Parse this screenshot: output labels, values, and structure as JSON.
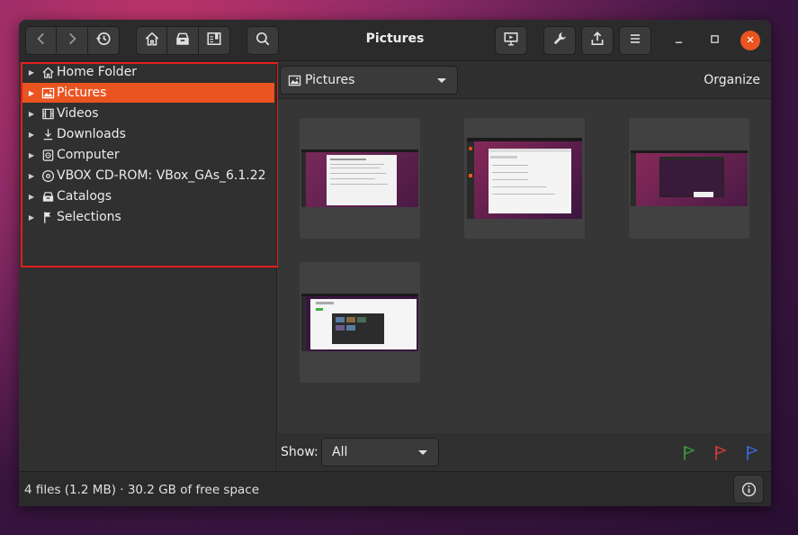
{
  "window": {
    "title": "Pictures"
  },
  "toolbar": {
    "back_icon": "chevron-left-icon",
    "forward_icon": "chevron-right-icon",
    "history_icon": "history-icon",
    "home_icon": "home-icon",
    "catalog_icon": "catalog-icon",
    "bookmarks_icon": "bookmarks-icon",
    "search_icon": "search-icon",
    "slideshow_icon": "slideshow-icon",
    "tools_icon": "wrench-icon",
    "share_icon": "share-icon",
    "menu_icon": "hamburger-menu-icon"
  },
  "sidebar": {
    "items": [
      {
        "label": "Home Folder",
        "icon": "home-icon"
      },
      {
        "label": "Pictures",
        "icon": "image-icon",
        "selected": true
      },
      {
        "label": "Videos",
        "icon": "film-icon"
      },
      {
        "label": "Downloads",
        "icon": "download-icon"
      },
      {
        "label": "Computer",
        "icon": "drive-icon"
      },
      {
        "label": "VBOX CD-ROM: VBox_GAs_6.1.22",
        "icon": "disc-icon"
      },
      {
        "label": "Catalogs",
        "icon": "catalog-icon"
      },
      {
        "label": "Selections",
        "icon": "flag-icon"
      }
    ]
  },
  "location": {
    "label": "Pictures",
    "icon": "image-icon"
  },
  "organize_label": "Organize",
  "thumbnails_count": 4,
  "filter": {
    "show_label": "Show:",
    "value": "All"
  },
  "flags": {
    "green": "#3c9a3c",
    "red": "#d83a3a",
    "blue": "#3a6ad8"
  },
  "status": {
    "text": "4 files (1.2 MB)  ·  30.2 GB of free space"
  },
  "colors": {
    "accent": "#e95420",
    "highlight_border": "#e11d1d"
  }
}
